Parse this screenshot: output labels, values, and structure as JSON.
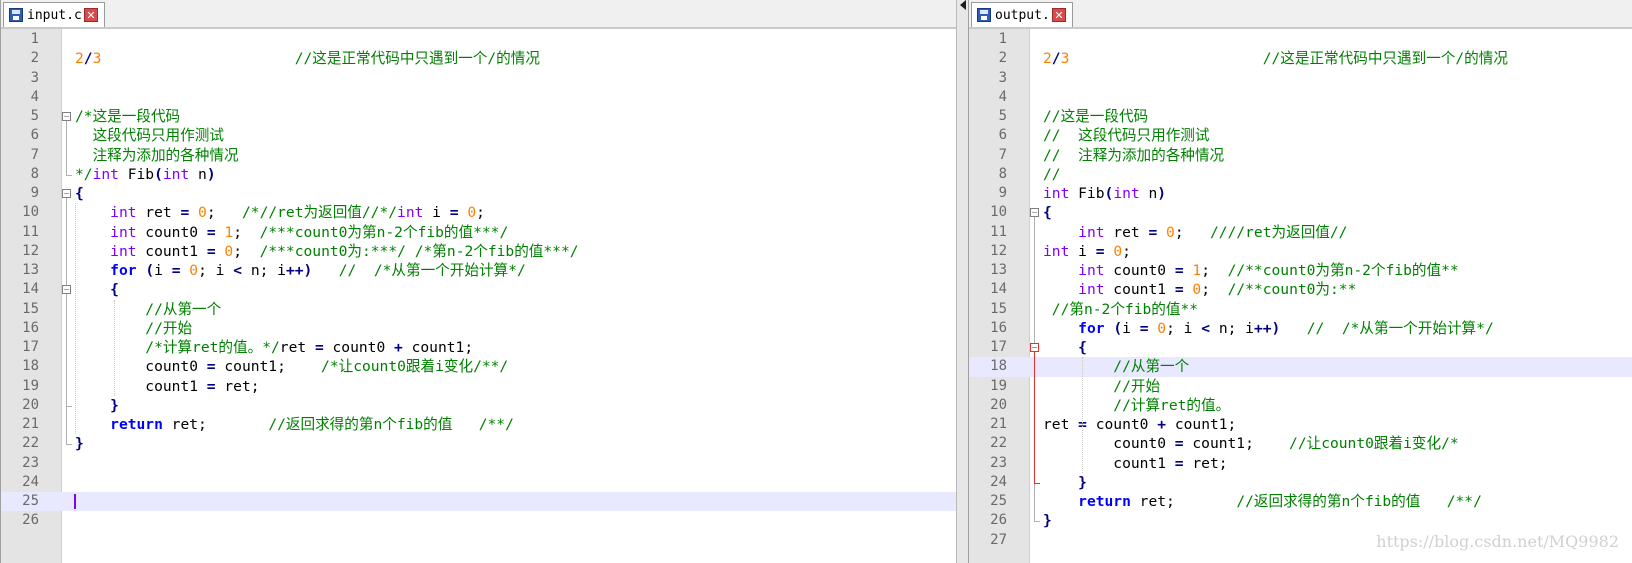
{
  "left": {
    "tab": {
      "name": "input.c",
      "close": "✕"
    },
    "caret_line": 25,
    "lines": [
      {
        "n": "1",
        "t": []
      },
      {
        "n": "2",
        "t": [
          [
            "num",
            "2"
          ],
          [
            "op",
            "/"
          ],
          [
            "num",
            "3"
          ],
          [
            "",
            "                      "
          ],
          [
            "cm",
            "//这是正常代码中只遇到一个/的情况"
          ]
        ]
      },
      {
        "n": "3",
        "t": []
      },
      {
        "n": "4",
        "t": []
      },
      {
        "n": "5",
        "t": [
          [
            "cm",
            "/*这是一段代码"
          ]
        ]
      },
      {
        "n": "6",
        "t": [
          [
            "cm",
            "  这段代码只用作测试"
          ]
        ]
      },
      {
        "n": "7",
        "t": [
          [
            "cm",
            "  注释为添加的各种情况"
          ]
        ]
      },
      {
        "n": "8",
        "t": [
          [
            "cm",
            "*/"
          ],
          [
            "kw",
            "int"
          ],
          [
            "",
            " Fib"
          ],
          [
            "op",
            "("
          ],
          [
            "kw",
            "int"
          ],
          [
            "",
            " n"
          ],
          [
            "op",
            ")"
          ]
        ]
      },
      {
        "n": "9",
        "t": [
          [
            "op",
            "{"
          ]
        ]
      },
      {
        "n": "10",
        "t": [
          [
            "",
            "    "
          ],
          [
            "kw",
            "int"
          ],
          [
            "",
            " ret "
          ],
          [
            "op",
            "="
          ],
          [
            "",
            "",
            " "
          ],
          [
            "num",
            "0"
          ],
          [
            "",
            ";   "
          ],
          [
            "cm",
            "/*//ret为返回值//*/"
          ],
          [
            "kw",
            "int"
          ],
          [
            "",
            " i "
          ],
          [
            "op",
            "="
          ],
          [
            "",
            " "
          ],
          [
            "num",
            "0"
          ],
          [
            "",
            ";"
          ]
        ]
      },
      {
        "n": "11",
        "t": [
          [
            "",
            "    "
          ],
          [
            "kw",
            "int"
          ],
          [
            "",
            " count0 "
          ],
          [
            "op",
            "="
          ],
          [
            "",
            " "
          ],
          [
            "num",
            "1"
          ],
          [
            "",
            ";  "
          ],
          [
            "cm",
            "/***count0为第n-2个fib的值***/"
          ]
        ]
      },
      {
        "n": "12",
        "t": [
          [
            "",
            "    "
          ],
          [
            "kw",
            "int"
          ],
          [
            "",
            " count1 "
          ],
          [
            "op",
            "="
          ],
          [
            "",
            " "
          ],
          [
            "num",
            "0"
          ],
          [
            "",
            ";  "
          ],
          [
            "cm",
            "/***count0为:***/ /*第n-2个fib的值***/"
          ]
        ]
      },
      {
        "n": "13",
        "t": [
          [
            "",
            "    "
          ],
          [
            "kwb",
            "for"
          ],
          [
            "",
            " "
          ],
          [
            "op",
            "("
          ],
          [
            "",
            "i "
          ],
          [
            "op",
            "="
          ],
          [
            "",
            " "
          ],
          [
            "num",
            "0"
          ],
          [
            "",
            "; i "
          ],
          [
            "op",
            "<"
          ],
          [
            "",
            " n; i"
          ],
          [
            "op",
            "++)"
          ],
          [
            "",
            "   "
          ],
          [
            "cm",
            "//  /*从第一个开始计算*/"
          ]
        ]
      },
      {
        "n": "14",
        "t": [
          [
            "",
            "    "
          ],
          [
            "op",
            "{"
          ]
        ]
      },
      {
        "n": "15",
        "t": [
          [
            "",
            "        "
          ],
          [
            "cm",
            "//从第一个"
          ]
        ]
      },
      {
        "n": "16",
        "t": [
          [
            "",
            "        "
          ],
          [
            "cm",
            "//开始"
          ]
        ]
      },
      {
        "n": "17",
        "t": [
          [
            "",
            "        "
          ],
          [
            "cm",
            "/*计算ret的值。*/"
          ],
          [
            "",
            "ret "
          ],
          [
            "op",
            "="
          ],
          [
            "",
            " count0 "
          ],
          [
            "op",
            "+"
          ],
          [
            "",
            " count1;"
          ]
        ]
      },
      {
        "n": "18",
        "t": [
          [
            "",
            "        count0 "
          ],
          [
            "op",
            "="
          ],
          [
            "",
            " count1;    "
          ],
          [
            "cm",
            "/*让count0跟着i变化/**/"
          ]
        ]
      },
      {
        "n": "19",
        "t": [
          [
            "",
            "        count1 "
          ],
          [
            "op",
            "="
          ],
          [
            "",
            " ret;"
          ]
        ]
      },
      {
        "n": "20",
        "t": [
          [
            "",
            "    "
          ],
          [
            "op",
            "}"
          ]
        ]
      },
      {
        "n": "21",
        "t": [
          [
            "",
            "    "
          ],
          [
            "kwb",
            "return"
          ],
          [
            "",
            " ret;       "
          ],
          [
            "cm",
            "//返回求得的第n个fib的值   /**/"
          ]
        ]
      },
      {
        "n": "22",
        "t": [
          [
            "op",
            "}"
          ]
        ]
      },
      {
        "n": "23",
        "t": []
      },
      {
        "n": "24",
        "t": []
      },
      {
        "n": "25",
        "t": []
      },
      {
        "n": "26",
        "t": []
      }
    ]
  },
  "right": {
    "tab": {
      "name": "output.c",
      "close": "✕"
    },
    "highlight_line": 18,
    "lines": [
      {
        "n": "1",
        "t": []
      },
      {
        "n": "2",
        "t": [
          [
            "num",
            "2"
          ],
          [
            "op",
            "/"
          ],
          [
            "num",
            "3"
          ],
          [
            "",
            "                      "
          ],
          [
            "cm",
            "//这是正常代码中只遇到一个/的情况"
          ]
        ]
      },
      {
        "n": "3",
        "t": []
      },
      {
        "n": "4",
        "t": []
      },
      {
        "n": "5",
        "t": [
          [
            "cm",
            "//这是一段代码"
          ]
        ]
      },
      {
        "n": "6",
        "t": [
          [
            "cm",
            "//  这段代码只用作测试"
          ]
        ]
      },
      {
        "n": "7",
        "t": [
          [
            "cm",
            "//  注释为添加的各种情况"
          ]
        ]
      },
      {
        "n": "8",
        "t": [
          [
            "cm",
            "//"
          ]
        ]
      },
      {
        "n": "9",
        "t": [
          [
            "kw",
            "int"
          ],
          [
            "",
            " Fib"
          ],
          [
            "op",
            "("
          ],
          [
            "kw",
            "int"
          ],
          [
            "",
            " n"
          ],
          [
            "op",
            ")"
          ]
        ]
      },
      {
        "n": "10",
        "t": [
          [
            "op",
            "{"
          ]
        ]
      },
      {
        "n": "11",
        "t": [
          [
            "",
            "    "
          ],
          [
            "kw",
            "int"
          ],
          [
            "",
            " ret "
          ],
          [
            "op",
            "="
          ],
          [
            "",
            " "
          ],
          [
            "num",
            "0"
          ],
          [
            "",
            ";   "
          ],
          [
            "cm",
            "////ret为返回值//"
          ]
        ]
      },
      {
        "n": "12",
        "t": [
          [
            "kw",
            "int"
          ],
          [
            "",
            " i "
          ],
          [
            "op",
            "="
          ],
          [
            "",
            " "
          ],
          [
            "num",
            "0"
          ],
          [
            "",
            ";"
          ]
        ]
      },
      {
        "n": "13",
        "t": [
          [
            "",
            "    "
          ],
          [
            "kw",
            "int"
          ],
          [
            "",
            " count0 "
          ],
          [
            "op",
            "="
          ],
          [
            "",
            " "
          ],
          [
            "num",
            "1"
          ],
          [
            "",
            ";  "
          ],
          [
            "cm",
            "//**count0为第n-2个fib的值**"
          ]
        ]
      },
      {
        "n": "14",
        "t": [
          [
            "",
            "    "
          ],
          [
            "kw",
            "int"
          ],
          [
            "",
            " count1 "
          ],
          [
            "op",
            "="
          ],
          [
            "",
            " "
          ],
          [
            "num",
            "0"
          ],
          [
            "",
            ";  "
          ],
          [
            "cm",
            "//**count0为:**"
          ]
        ]
      },
      {
        "n": "15",
        "t": [
          [
            "",
            " "
          ],
          [
            "cm",
            "//第n-2个fib的值**"
          ]
        ]
      },
      {
        "n": "16",
        "t": [
          [
            "",
            "    "
          ],
          [
            "kwb",
            "for"
          ],
          [
            "",
            " "
          ],
          [
            "op",
            "("
          ],
          [
            "",
            "i "
          ],
          [
            "op",
            "="
          ],
          [
            "",
            " "
          ],
          [
            "num",
            "0"
          ],
          [
            "",
            "; i "
          ],
          [
            "op",
            "<"
          ],
          [
            "",
            " n; i"
          ],
          [
            "op",
            "++)"
          ],
          [
            "",
            "   "
          ],
          [
            "cm",
            "//  /*从第一个开始计算*/"
          ]
        ]
      },
      {
        "n": "17",
        "t": [
          [
            "",
            "    "
          ],
          [
            "op",
            "{"
          ]
        ]
      },
      {
        "n": "18",
        "t": [
          [
            "",
            "        "
          ],
          [
            "cm",
            "//从第一个"
          ]
        ]
      },
      {
        "n": "19",
        "t": [
          [
            "",
            "        "
          ],
          [
            "cm",
            "//开始"
          ]
        ]
      },
      {
        "n": "20",
        "t": [
          [
            "",
            "        "
          ],
          [
            "cm",
            "//计算ret的值。"
          ]
        ]
      },
      {
        "n": "21",
        "t": [
          [
            "",
            "ret "
          ],
          [
            "op",
            "="
          ],
          [
            "",
            " count0 "
          ],
          [
            "op",
            "+"
          ],
          [
            "",
            " count1;"
          ]
        ]
      },
      {
        "n": "22",
        "t": [
          [
            "",
            "        count0 "
          ],
          [
            "op",
            "="
          ],
          [
            "",
            " count1;    "
          ],
          [
            "cm",
            "//让count0跟着i变化/*"
          ]
        ]
      },
      {
        "n": "23",
        "t": [
          [
            "",
            "        count1 "
          ],
          [
            "op",
            "="
          ],
          [
            "",
            " ret;"
          ]
        ]
      },
      {
        "n": "24",
        "t": [
          [
            "",
            "    "
          ],
          [
            "op",
            "}"
          ]
        ]
      },
      {
        "n": "25",
        "t": [
          [
            "",
            "    "
          ],
          [
            "kwb",
            "return"
          ],
          [
            "",
            " ret;       "
          ],
          [
            "cm",
            "//返回求得的第n个fib的值   /**/"
          ]
        ]
      },
      {
        "n": "26",
        "t": [
          [
            "op",
            "}"
          ]
        ]
      },
      {
        "n": "27",
        "t": []
      }
    ]
  },
  "watermark": "https://blog.csdn.net/MQ9982"
}
